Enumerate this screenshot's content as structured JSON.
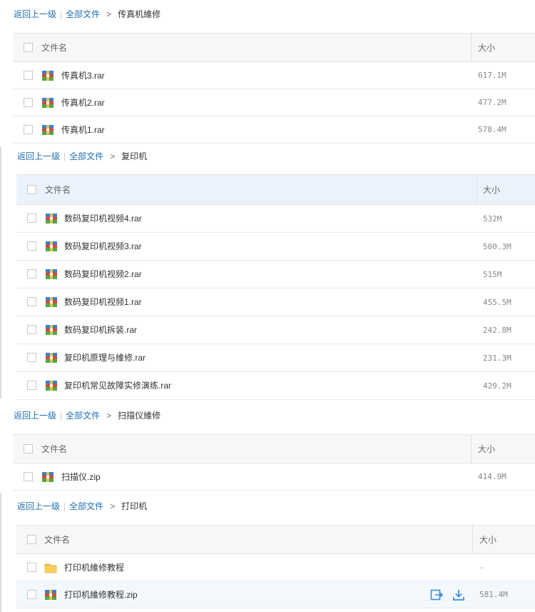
{
  "sections": [
    {
      "crumb": {
        "back": "返回上一级",
        "all": "全部文件",
        "current": "传真机維修"
      },
      "header": {
        "name": "文件名",
        "size": "大小"
      },
      "files": [
        {
          "name": "传真机3.rar",
          "size": "617.1M",
          "icon": "rar-icon"
        },
        {
          "name": "传真机2.rar",
          "size": "477.2M",
          "icon": "rar-icon"
        },
        {
          "name": "传真机1.rar",
          "size": "578.4M",
          "icon": "rar-icon"
        }
      ]
    },
    {
      "crumb": {
        "back": "返回上一级",
        "all": "全部文件",
        "current": "复印机"
      },
      "header": {
        "name": "文件名",
        "size": "大小"
      },
      "files": [
        {
          "name": "数码复印机视频4.rar",
          "size": "532M",
          "icon": "rar-icon"
        },
        {
          "name": "数码复印机视频3.rar",
          "size": "500.3M",
          "icon": "rar-icon"
        },
        {
          "name": "数码复印机视频2.rar",
          "size": "515M",
          "icon": "rar-icon"
        },
        {
          "name": "数码复印机视频1.rar",
          "size": "455.5M",
          "icon": "rar-icon"
        },
        {
          "name": "数码复印机拆装.rar",
          "size": "242.8M",
          "icon": "rar-icon"
        },
        {
          "name": "复印机原理与維修.rar",
          "size": "231.3M",
          "icon": "rar-icon"
        },
        {
          "name": "复印机常见故障实修演练.rar",
          "size": "429.2M",
          "icon": "rar-icon"
        }
      ]
    },
    {
      "crumb": {
        "back": "返回上一级",
        "all": "全部文件",
        "current": "扫描仪維修"
      },
      "header": {
        "name": "文件名",
        "size": "大小"
      },
      "files": [
        {
          "name": "扫描仪.zip",
          "size": "414.9M",
          "icon": "zip-icon"
        }
      ]
    },
    {
      "crumb": {
        "back": "返回上一级",
        "all": "全部文件",
        "current": "打印机"
      },
      "header": {
        "name": "文件名",
        "size": "大小"
      },
      "files": [
        {
          "name": "打印机維修教程",
          "size": "-",
          "icon": "folder-icon"
        },
        {
          "name": "打印机維修教程.zip",
          "size": "581.4M",
          "icon": "zip-icon"
        }
      ]
    }
  ],
  "colors": {
    "link": "#1f6fb2",
    "header_bg": "#f7f7f7",
    "header_bg_active": "#eaf3fb",
    "row_hover": "#f3f8fd",
    "action_icon": "#3a8fd6"
  }
}
